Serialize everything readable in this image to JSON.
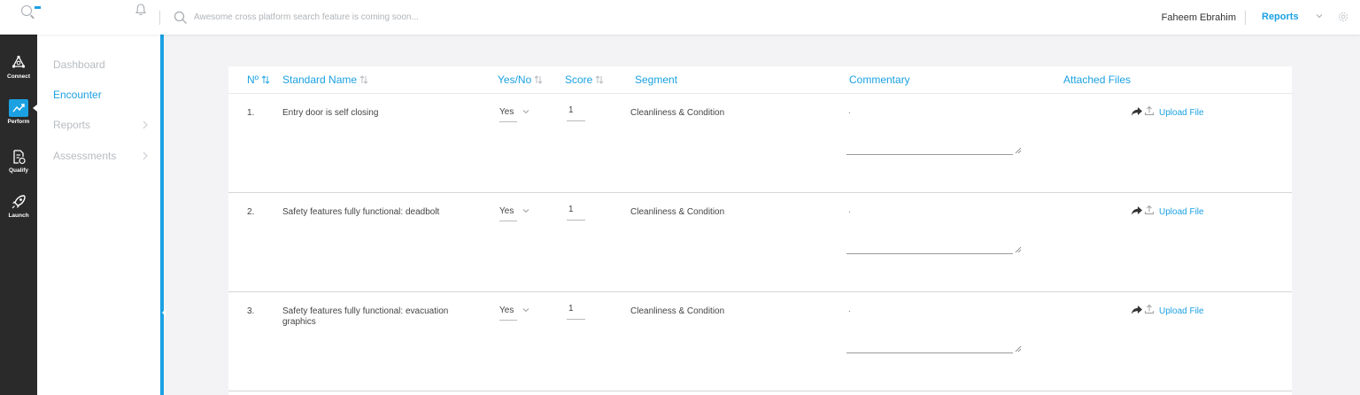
{
  "topbar": {
    "search_placeholder": "Awesome cross platform search feature is coming soon...",
    "user_name": "Faheem Ebrahim",
    "module_label": "Reports"
  },
  "leftnav": {
    "items": [
      {
        "label": "Connect",
        "icon": "connect-icon"
      },
      {
        "label": "Perform",
        "icon": "trend-icon",
        "active": true
      },
      {
        "label": "Qualify",
        "icon": "qualify-icon"
      },
      {
        "label": "Launch",
        "icon": "rocket-icon"
      }
    ]
  },
  "subnav": {
    "items": [
      {
        "label": "Dashboard"
      },
      {
        "label": "Encounter",
        "active": true
      },
      {
        "label": "Reports",
        "has_children": true
      },
      {
        "label": "Assessments",
        "has_children": true
      }
    ]
  },
  "table": {
    "headers": {
      "num": "Nº",
      "standard_name": "Standard Name",
      "yes_no": "Yes/No",
      "score": "Score",
      "segment": "Segment",
      "commentary": "Commentary",
      "attached_files": "Attached Files"
    },
    "rows": [
      {
        "num": "1.",
        "name": "Entry door is self closing",
        "yes_no": "Yes",
        "score": "1",
        "segment": "Cleanliness & Condition",
        "commentary": ".",
        "upload_label": "Upload File"
      },
      {
        "num": "2.",
        "name": "Safety features fully functional: deadbolt",
        "yes_no": "Yes",
        "score": "1",
        "segment": "Cleanliness & Condition",
        "commentary": ".",
        "upload_label": "Upload File"
      },
      {
        "num": "3.",
        "name": "Safety features fully functional: evacuation graphics",
        "yes_no": "Yes",
        "score": "1",
        "segment": "Cleanliness & Condition",
        "commentary": ".",
        "upload_label": "Upload File"
      }
    ]
  },
  "colors": {
    "accent": "#1ba1e2",
    "nav_bg": "#2a2a2a",
    "page_bg": "#f3f3f5"
  }
}
